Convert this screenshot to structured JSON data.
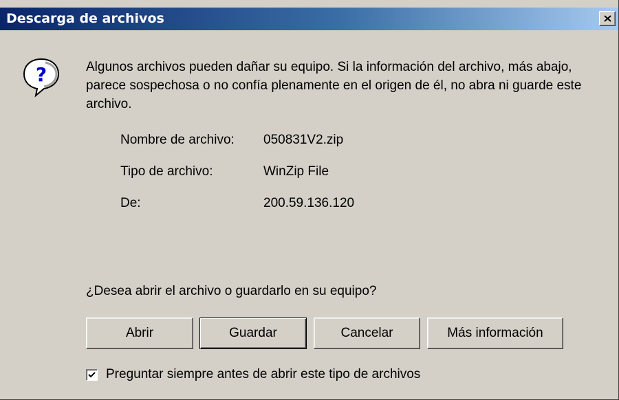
{
  "window": {
    "title": "Descarga de archivos"
  },
  "message": {
    "text": "Algunos archivos pueden dañar su equipo. Si la información del archivo, más abajo, parece sospechosa o no confía plenamente en el origen de él, no abra ni guarde este archivo."
  },
  "file_info": {
    "name_label": "Nombre de archivo:",
    "name_value": "050831V2.zip",
    "type_label": "Tipo de archivo:",
    "type_value": "WinZip File",
    "from_label": "De:",
    "from_value": "200.59.136.120"
  },
  "prompt": {
    "question": "¿Desea abrir el archivo o guardarlo en su equipo?"
  },
  "buttons": {
    "open": "Abrir",
    "save": "Guardar",
    "cancel": "Cancelar",
    "more_info": "Más información"
  },
  "checkbox": {
    "label": "Preguntar siempre antes de abrir este tipo de archivos",
    "checked": true
  },
  "icons": {
    "question": "question-icon",
    "close": "close-icon",
    "check": "checkmark-icon"
  },
  "colors": {
    "titlebar_start": "#0a246a",
    "titlebar_end": "#a6caf0",
    "dialog_bg": "#d4d0c8"
  }
}
